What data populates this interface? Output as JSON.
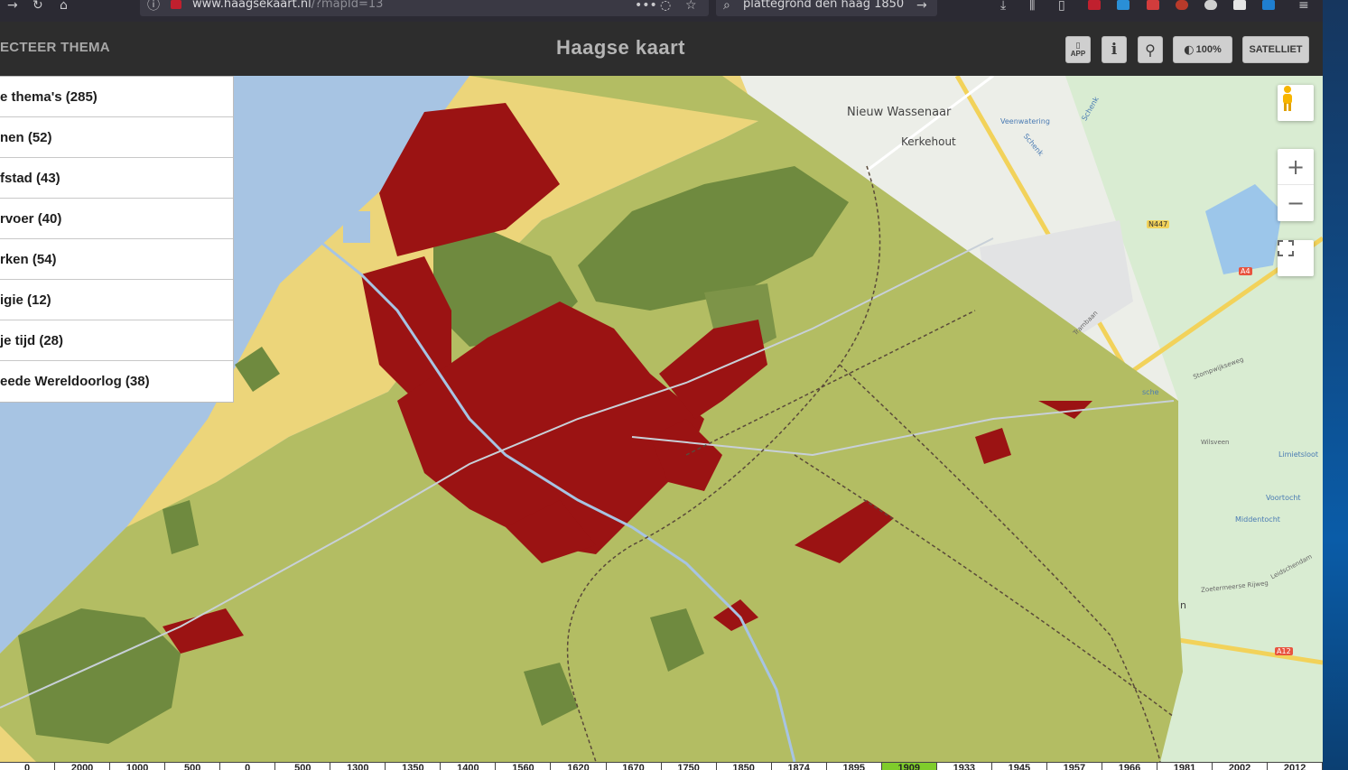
{
  "browser": {
    "url_host": "www.haagsekaart.nl",
    "url_path": "/?mapId=13",
    "search_query": "plattegrond den haag 1850"
  },
  "header": {
    "select_theme_label": "ECTEER THEMA",
    "title": "Haagse kaart",
    "app_label": "APP",
    "info_label": "i",
    "opacity_label": "100%",
    "satellite_label": "SATELLIET"
  },
  "themes": [
    {
      "label": "e thema's (285)"
    },
    {
      "label": "nen (52)"
    },
    {
      "label": "fstad (43)"
    },
    {
      "label": "rvoer (40)"
    },
    {
      "label": "rken (54)"
    },
    {
      "label": "igie (12)"
    },
    {
      "label": "je tijd (28)"
    },
    {
      "label": "eede Wereldoorlog (38)"
    }
  ],
  "map_labels": {
    "nieuw_wassenaar": "Nieuw Wassenaar",
    "kerkehout": "Kerkehout",
    "veenwatering": "Veenwatering",
    "schenk": "Schenk",
    "n447": "N447",
    "a4": "A4",
    "trambaan": "Trambaan",
    "stompwijkseweg": "Stompwijkseweg",
    "wilsveen": "Wilsveen",
    "limietsloot": "Limietsloot",
    "voortocht": "Voortocht",
    "middentocht": "Middentocht",
    "leidschendam": "Leidschendam",
    "zoetermeerse_rijweg": "Zoetermeerse Rijweg",
    "a12": "A12",
    "sche": "sche",
    "n": "n"
  },
  "timeline": {
    "years": [
      "0",
      "2000",
      "1000",
      "500",
      "0",
      "500",
      "1300",
      "1350",
      "1400",
      "1560",
      "1620",
      "1670",
      "1750",
      "1850",
      "1874",
      "1895",
      "1909",
      "1933",
      "1945",
      "1957",
      "1966",
      "1981",
      "2002",
      "2012"
    ],
    "active_year": "1909"
  },
  "colors": {
    "water": "#a7c4e3",
    "dunes": "#ecd57a",
    "polder": "#b3bd63",
    "forest": "#6f8a3f",
    "built": "#9b1313",
    "timeline_active": "#7fcc2b"
  }
}
